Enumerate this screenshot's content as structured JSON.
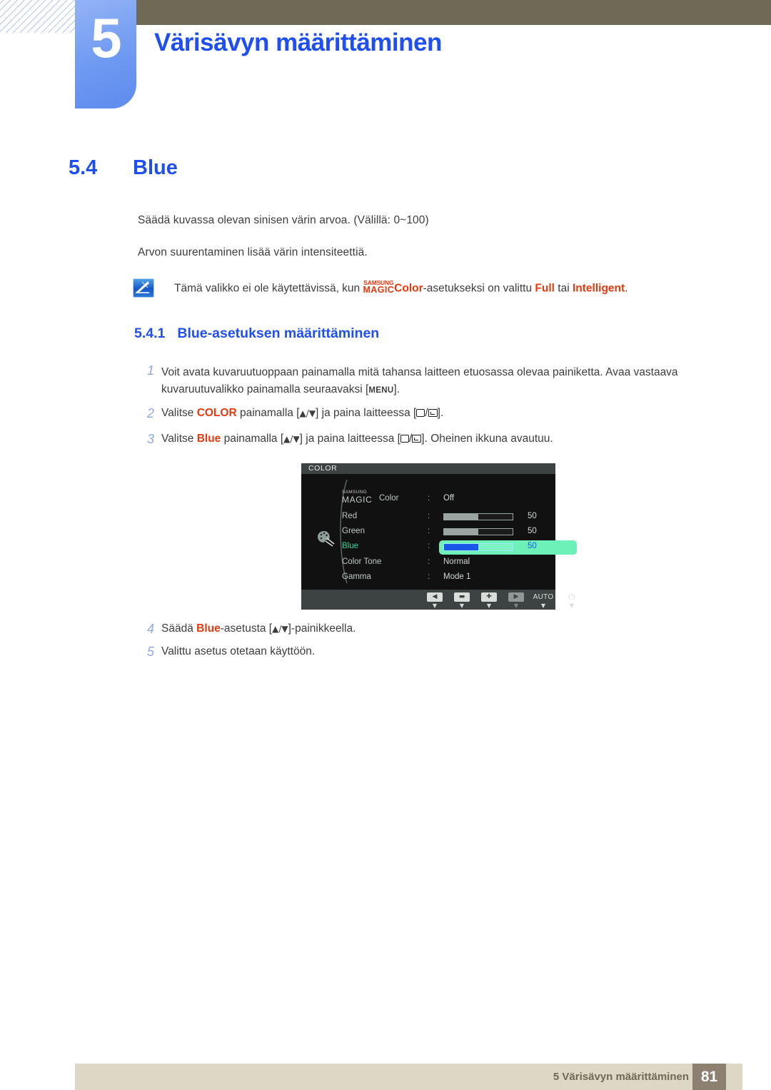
{
  "header": {
    "chapter_number": "5",
    "chapter_title": "Värisävyn määrittäminen",
    "tab_color": "#6f9af2",
    "bar_color": "#6e6a55"
  },
  "section": {
    "number": "5.4",
    "title": "Blue",
    "paragraph_1": "Säädä kuvassa olevan sinisen värin arvoa. (Välillä: 0~100)",
    "paragraph_2": "Arvon suurentaminen lisää värin intensiteettiä."
  },
  "note": {
    "icon": "note-pen-icon",
    "text_before": "Tämä valikko ei ole käytettävissä, kun ",
    "logo_line1": "SAMSUNG",
    "logo_line2": "MAGIC",
    "logo_suffix": "Color",
    "text_middle": "-asetukseksi on valittu ",
    "highlight_1": "Full",
    "text_conj": " tai ",
    "highlight_2": "Intelligent",
    "text_end": ".",
    "highlight_color": "#e8380d"
  },
  "subsection": {
    "number": "5.4.1",
    "title": "Blue-asetuksen määrittäminen"
  },
  "steps": [
    {
      "number": "1",
      "parts": [
        {
          "t": "Voit avata kuvaruutuoppaan painamalla mitä tahansa laitteen etuosassa olevaa painiketta. Avaa vastaava kuvaruutuvalikko painamalla seuraavaksi [",
          "style": "plain"
        },
        {
          "t": "MENU",
          "style": "keycap"
        },
        {
          "t": "].",
          "style": "plain"
        }
      ]
    },
    {
      "number": "2",
      "parts": [
        {
          "t": "Valitse ",
          "style": "plain"
        },
        {
          "t": "COLOR",
          "style": "accent"
        },
        {
          "t": " painamalla [",
          "style": "plain"
        },
        {
          "t": "▲/▼",
          "style": "arrows"
        },
        {
          "t": "] ja paina laitteessa [",
          "style": "plain"
        },
        {
          "t": "box/enter",
          "style": "boxenter"
        },
        {
          "t": "].",
          "style": "plain"
        }
      ]
    },
    {
      "number": "3",
      "parts": [
        {
          "t": "Valitse ",
          "style": "plain"
        },
        {
          "t": "Blue",
          "style": "accent"
        },
        {
          "t": " painamalla [",
          "style": "plain"
        },
        {
          "t": "▲/▼",
          "style": "arrows"
        },
        {
          "t": "] ja paina laitteessa [",
          "style": "plain"
        },
        {
          "t": "box/enter",
          "style": "boxenter"
        },
        {
          "t": "]. Oheinen ikkuna avautuu.",
          "style": "plain"
        }
      ]
    },
    {
      "number": "4",
      "parts": [
        {
          "t": "Säädä ",
          "style": "plain"
        },
        {
          "t": "Blue",
          "style": "accent"
        },
        {
          "t": "-asetusta [",
          "style": "plain"
        },
        {
          "t": "▲/▼",
          "style": "arrows"
        },
        {
          "t": "]-painikkeella.",
          "style": "plain"
        }
      ]
    },
    {
      "number": "5",
      "parts": [
        {
          "t": "Valittu asetus otetaan käyttöön.",
          "style": "plain"
        }
      ]
    }
  ],
  "step_texts": {
    "s1_line1": "Voit avata kuvaruutuoppaan painamalla mitä tahansa laitteen etuosassa olevaa painiketta. Avaa",
    "s1_line2_pre": "vastaava kuvaruutuvalikko painamalla seuraavaksi [",
    "s1_menu": "MENU",
    "s1_line2_post": "].",
    "s2_pre": "Valitse ",
    "s2_accent": "COLOR",
    "s2_mid": " painamalla [",
    "s2_arrows": "▲/▼",
    "s2_mid2": "] ja paina laitteessa [",
    "s2_post": "].",
    "s3_pre": "Valitse ",
    "s3_accent": "Blue",
    "s3_mid": " painamalla [",
    "s3_arrows": "▲/▼",
    "s3_mid2": "] ja paina laitteessa [",
    "s3_post": "]. Oheinen ikkuna avautuu.",
    "s4_pre": "Säädä ",
    "s4_accent": "Blue",
    "s4_mid": "-asetusta [",
    "s4_arrows": "▲/▼",
    "s4_post": "]-painikkeella.",
    "s5_text": "Valittu asetus otetaan käyttöön.",
    "n1": "1",
    "n2": "2",
    "n3": "3",
    "n4": "4",
    "n5": "5"
  },
  "osd": {
    "title": "COLOR",
    "palette_icon": "palette-icon",
    "rows": [
      {
        "label_line1": "SAMSUNG",
        "label_line2": "MAGIC",
        "label_suffix": "Color",
        "colon": ":",
        "value": "Off",
        "type": "value"
      },
      {
        "label": "Red",
        "colon": ":",
        "number": "50",
        "fill_percent": 50,
        "type": "slider"
      },
      {
        "label": "Green",
        "colon": ":",
        "number": "50",
        "fill_percent": 50,
        "type": "slider"
      },
      {
        "label": "Blue",
        "colon": ":",
        "number": "50",
        "fill_percent": 50,
        "type": "slider-selected"
      },
      {
        "label": "Color Tone",
        "colon": ":",
        "value": "Normal",
        "type": "value"
      },
      {
        "label": "Gamma",
        "colon": ":",
        "value": "Mode 1",
        "type": "value"
      }
    ],
    "buttons": [
      {
        "name": "prev-button",
        "glyph": "◀",
        "caret": "▼",
        "dim": false
      },
      {
        "name": "minus-button",
        "glyph": "▬",
        "caret": "▼",
        "dim": false
      },
      {
        "name": "plus-button",
        "glyph": "✚",
        "caret": "▼",
        "dim": false
      },
      {
        "name": "next-button",
        "glyph": "▶",
        "caret": "▼",
        "dim": true
      },
      {
        "name": "auto-button",
        "glyph": "AUTO",
        "caret": "▼",
        "dim": false
      },
      {
        "name": "power-button",
        "glyph": "⏻",
        "caret": "▼",
        "dim": false
      }
    ],
    "selected_color": "#33d99a",
    "highlight_color": "#6ef0b9",
    "slider_fill_color": "#1857e8"
  },
  "footer": {
    "text": "5 Värisävyn määrittäminen",
    "page_number": "81",
    "bar_color": "#ddd7c5",
    "page_box_color": "#8d8071"
  }
}
